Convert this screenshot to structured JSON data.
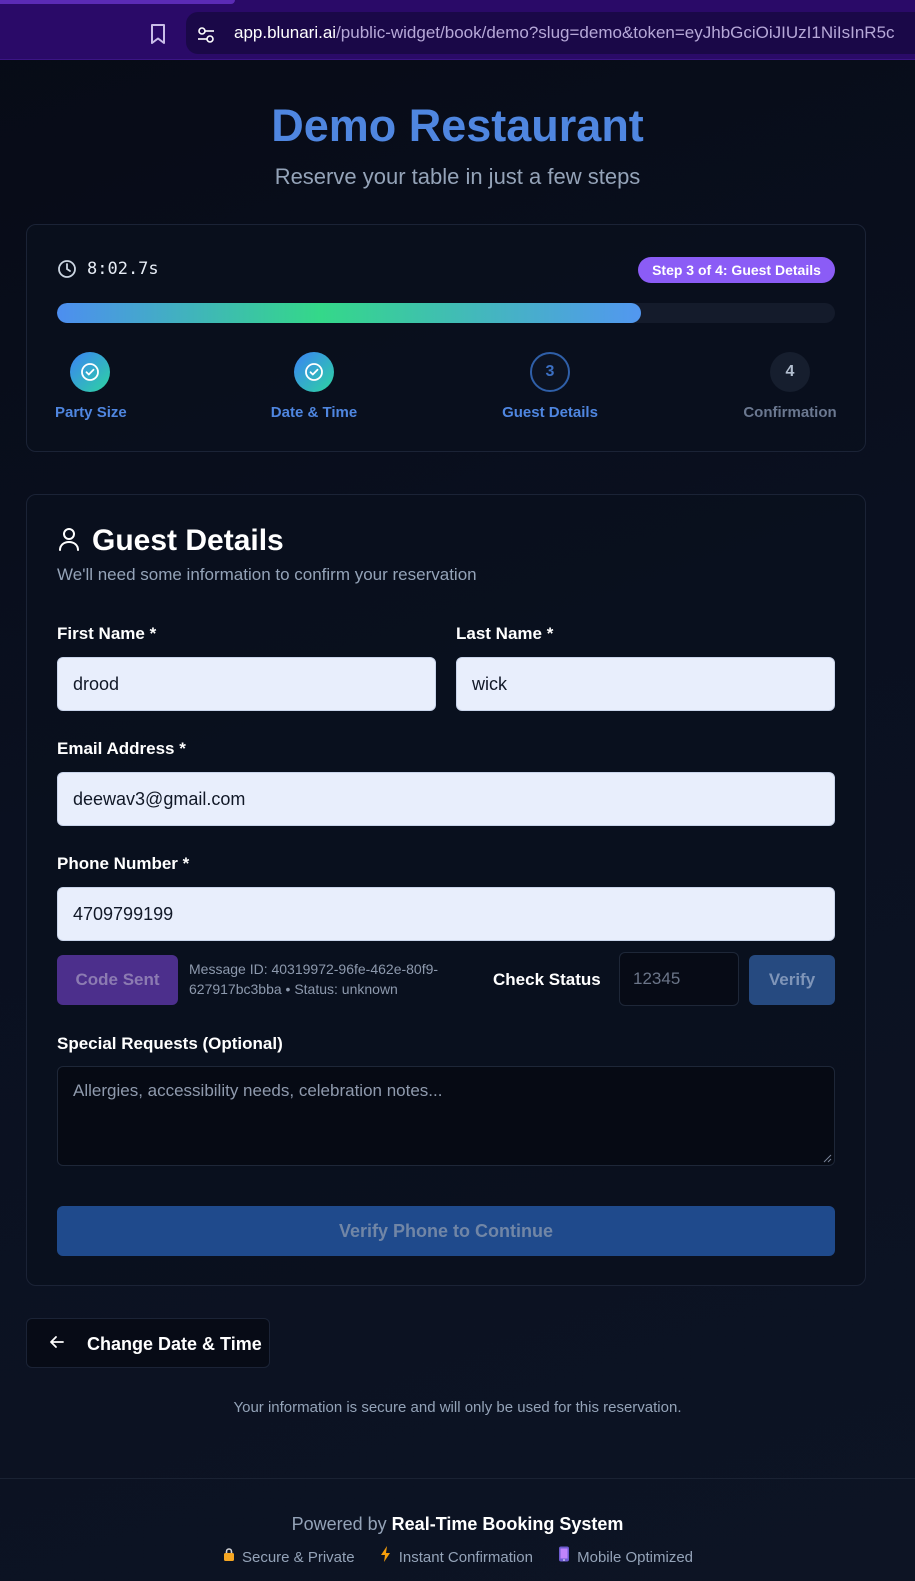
{
  "browser": {
    "url_host": "app.blunari.ai",
    "url_path": "/public-widget/book/demo?slug=demo&token=eyJhbGciOiJIUzI1NiIsInR5c"
  },
  "header": {
    "title": "Demo Restaurant",
    "subtitle": "Reserve your table in just a few steps"
  },
  "progress": {
    "timer": "8:02.7s",
    "badge": "Step 3 of 4: Guest Details",
    "fill_percent": 75,
    "steps": [
      {
        "label": "Party Size",
        "state": "done",
        "number": ""
      },
      {
        "label": "Date & Time",
        "state": "done",
        "number": ""
      },
      {
        "label": "Guest Details",
        "state": "active",
        "number": "3"
      },
      {
        "label": "Confirmation",
        "state": "pending",
        "number": "4"
      }
    ]
  },
  "form": {
    "title": "Guest Details",
    "subtitle": "We'll need some information to confirm your reservation",
    "first_name_label": "First Name *",
    "first_name_value": "drood",
    "last_name_label": "Last Name *",
    "last_name_value": "wick",
    "email_label": "Email Address *",
    "email_value": "deewav3@gmail.com",
    "phone_label": "Phone Number *",
    "phone_value": "4709799199",
    "code_sent_label": "Code Sent",
    "message_id": "Message ID: 40319972-96fe-462e-80f9-627917bc3bba • Status: unknown",
    "check_status_label": "Check Status",
    "code_placeholder": "12345",
    "verify_label": "Verify",
    "special_requests_label": "Special Requests (Optional)",
    "special_requests_placeholder": "Allergies, accessibility needs, celebration notes...",
    "continue_label": "Verify Phone to Continue"
  },
  "back_button_label": "Change Date & Time",
  "secure_note": "Your information is secure and will only be used for this reservation.",
  "footer": {
    "powered_prefix": "Powered by",
    "powered_brand": "Real-Time Booking System",
    "features": [
      {
        "icon": "lock-icon",
        "label": "Secure & Private"
      },
      {
        "icon": "lightning-icon",
        "label": "Instant Confirmation"
      },
      {
        "icon": "phone-icon",
        "label": "Mobile Optimized"
      }
    ]
  },
  "colors": {
    "accent": "#4f86e0",
    "badge": "#8b5cf6"
  }
}
